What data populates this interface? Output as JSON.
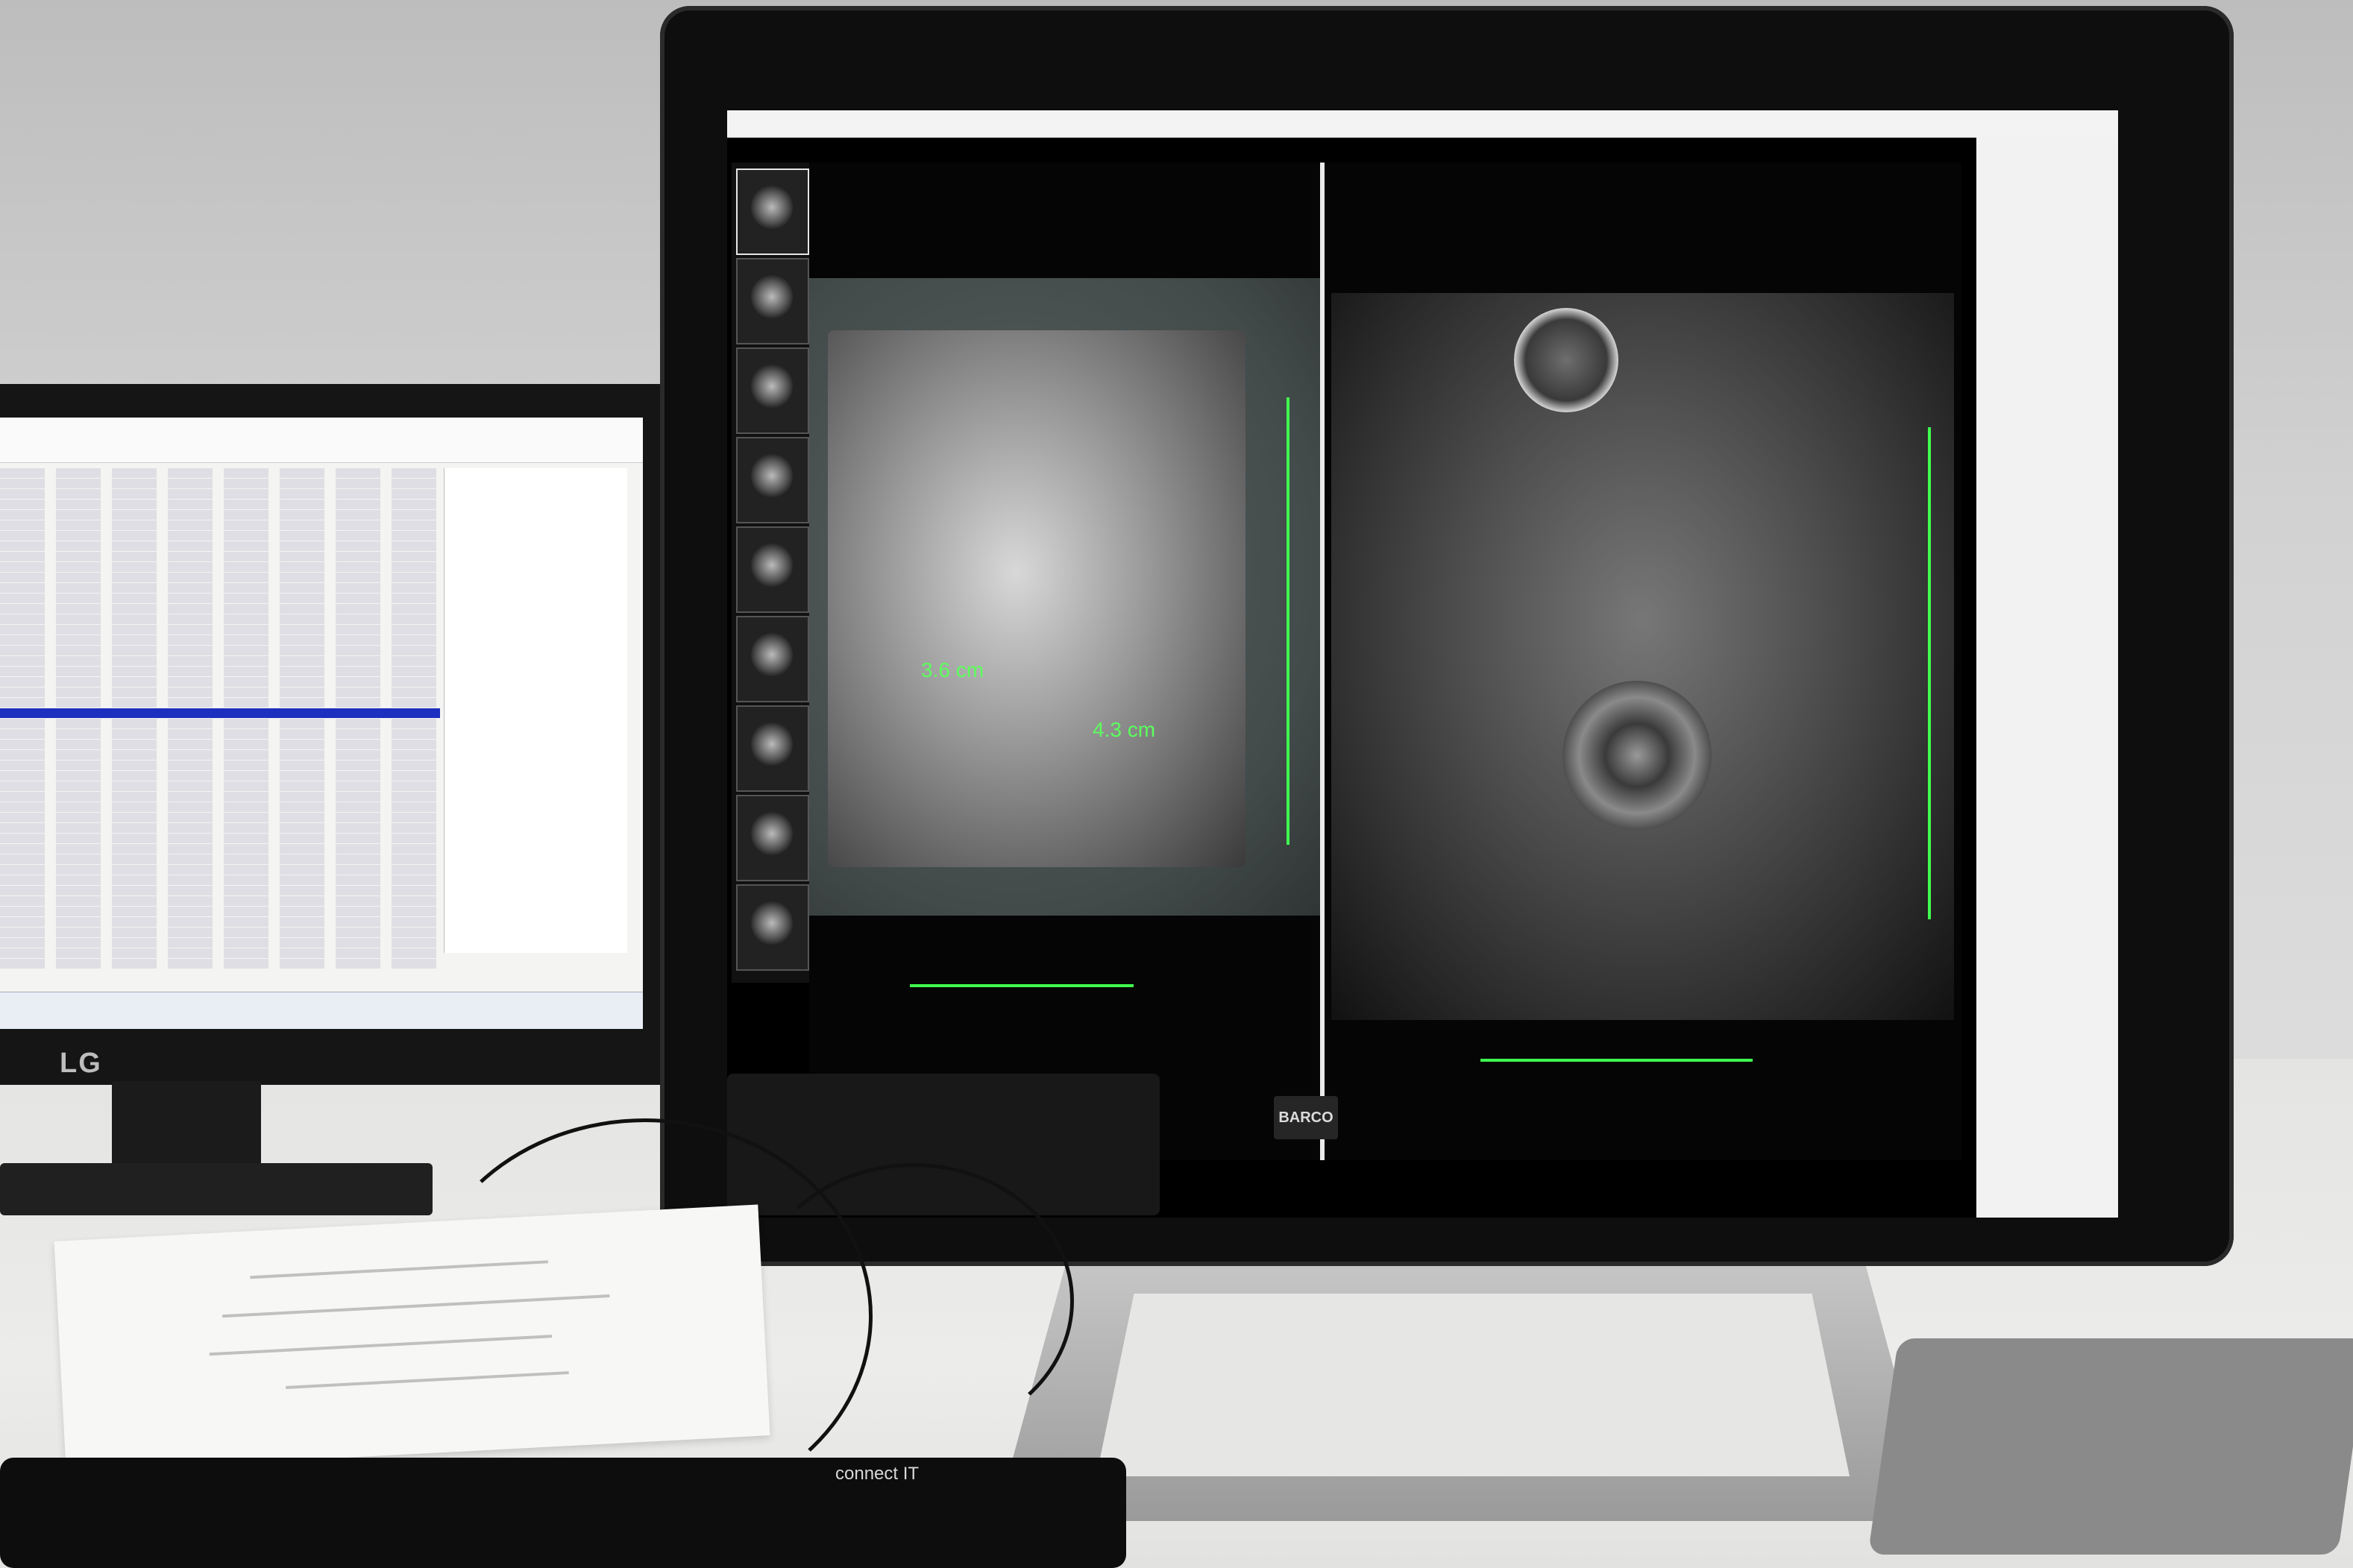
{
  "scene": {
    "left_monitor_brand": "LG",
    "main_monitor_brand": "BARCO",
    "keyboard_brand": "connect IT"
  },
  "viewer": {
    "measurements": [
      "3.6 cm",
      "4.3 cm"
    ]
  },
  "colors": {
    "ruler_green": "#3fff4f",
    "selected_row_blue": "#1d2fbf"
  },
  "icons": {
    "left_monitor": "worklist-table",
    "main_monitor": "mri-viewer"
  }
}
